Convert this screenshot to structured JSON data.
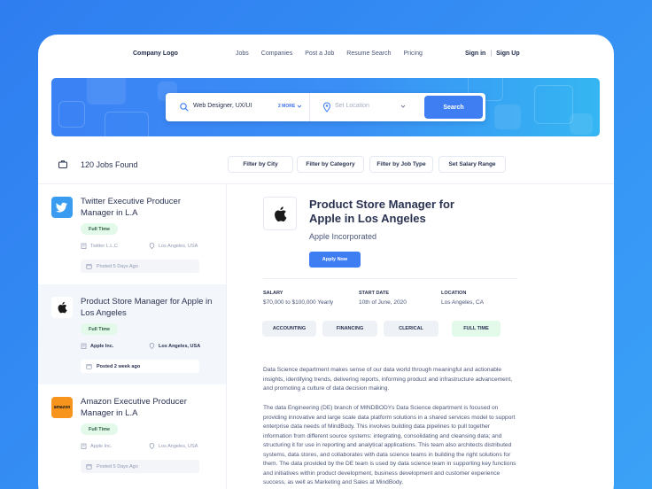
{
  "nav": {
    "logo": "Company Logo",
    "links": [
      "Jobs",
      "Companies",
      "Post a Job",
      "Resume Search",
      "Pricing"
    ],
    "sign_in": "Sign in",
    "separator": "|",
    "sign_up": "Sign Up"
  },
  "search": {
    "keyword_value": "Web Designer, UX/UI",
    "more_label": "2 MORE",
    "location_placeholder": "Set Location",
    "button_label": "Search"
  },
  "results": {
    "count_label": "120 Jobs Found",
    "filters": [
      "Filter by City",
      "Filter by Category",
      "Filter by Job Type",
      "Set Salary Range"
    ]
  },
  "jobs": [
    {
      "title": "Twitter Executive Producer Manager in L.A",
      "type": "Full Time",
      "company": "Twitter L.L.C",
      "location": "Los Angeles, USA",
      "posted": "Posted 5 Days Ago",
      "logo": "twitter-bird-icon",
      "logo_color": "#3a9cf0"
    },
    {
      "title": "Product Store Manager for Apple in Los Angeles",
      "type": "Full Time",
      "company": "Apple Inc.",
      "location": "Los Angeles, USA",
      "posted": "Posted 2 week ago",
      "logo": "apple-icon",
      "logo_color": "#ffffff"
    },
    {
      "title": "Amazon Executive Producer Manager in L.A",
      "type": "Full Time",
      "company": "Apple Inc.",
      "location": "Los Angeles, USA",
      "posted": "Posted 5 Days Ago",
      "logo": "amazon-logo",
      "logo_text": "amazon",
      "logo_color": "#f7941d"
    }
  ],
  "detail": {
    "title": "Product Store Manager for Apple in Los Angeles",
    "company": "Apple Incorporated",
    "apply_label": "Apply Now",
    "salary_label": "SALARY",
    "salary_value": "$70,000 to $100,000 Yearly",
    "start_label": "START DATE",
    "start_value": "10th of June, 2020",
    "location_label": "LOCATION",
    "location_value": "Los Angeles, CA",
    "tags": [
      "ACCOUNTING",
      "FINANCING",
      "CLERICAL",
      "FULL TIME"
    ],
    "paragraph_1": "Data Science department makes sense of our data world through meaningful and actionable insights, identifying trends, delivering reports, informing product and infrastructure advancement, and promoting a culture of data decision making.",
    "paragraph_2": "The data Engineering (DE) branch of MINDBODYs Data Science department is focused on providing innovative and large scale data platform solutions in a shared services model to support enterprise data needs of MindBody. This involves building data pipelines to pull together information from different source systems: integrating, consolidating and cleansing data;  and structuring it for use in reporting and analytical applications. This team also architects distributed systems, data stores, and collaborates with data science teams in building the right solutions for them. The data provided by the DE team is used by data science team in supporting key functions and initiatives within product development, business development and customer experience success, as well as Marketing and Sales at MindBody."
  },
  "colors": {
    "primary": "#3e7ef2",
    "text_dark": "#2a3352",
    "badge_green": "#e3f9ea"
  }
}
